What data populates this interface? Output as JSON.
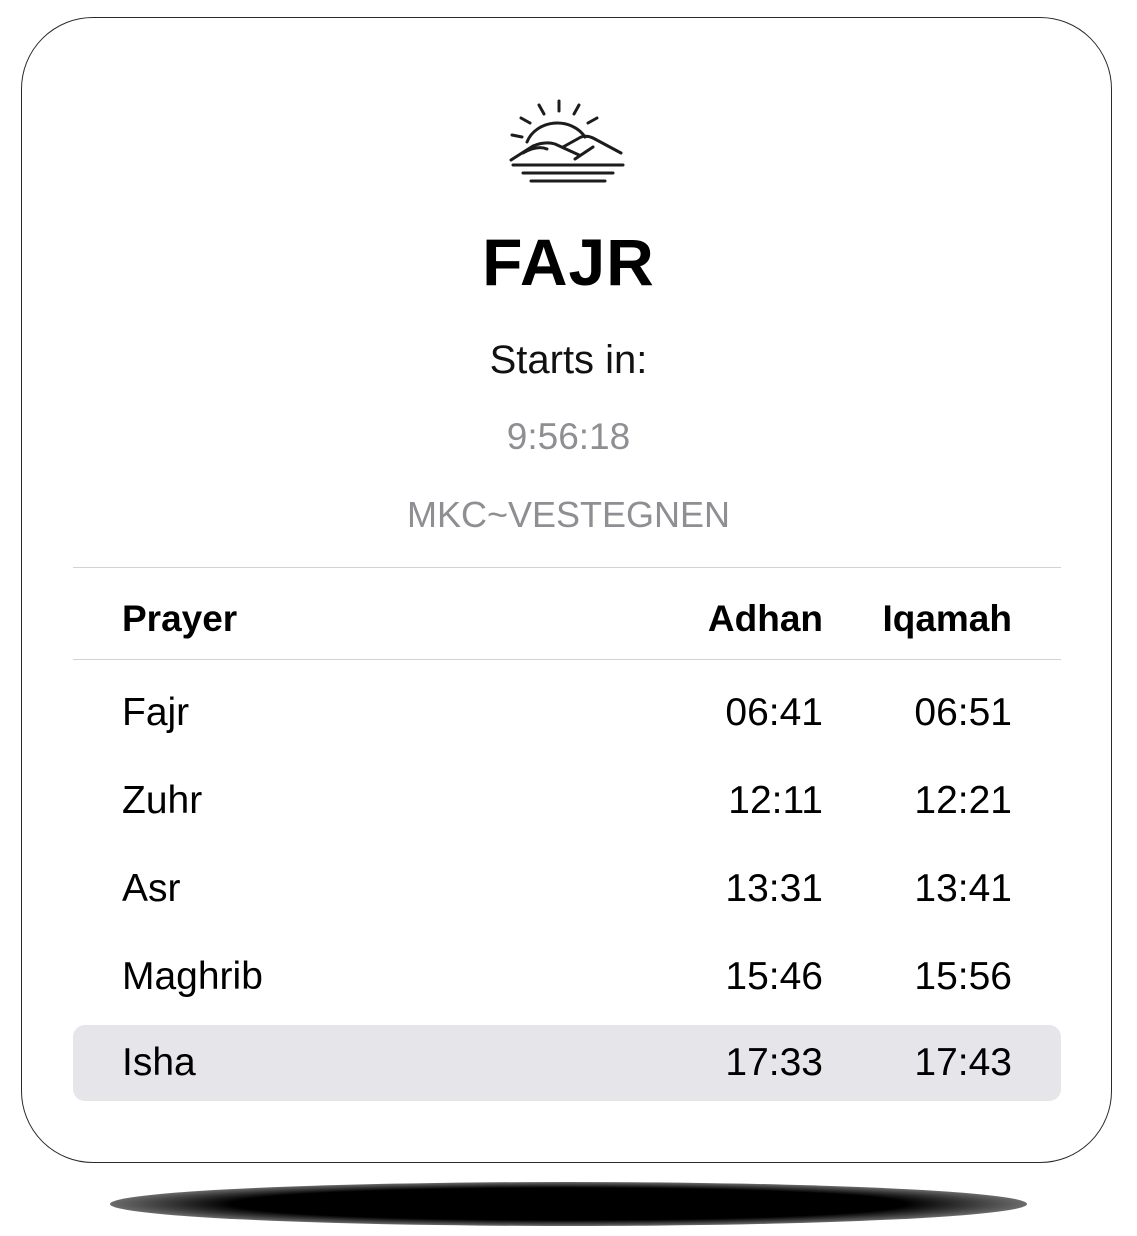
{
  "widget": {
    "icon": "sunrise-icon",
    "next_prayer": "FAJR",
    "starts_label": "Starts in:",
    "countdown": "9:56:18",
    "location": "MKC~VESTEGNEN"
  },
  "table": {
    "headers": {
      "prayer": "Prayer",
      "adhan": "Adhan",
      "iqamah": "Iqamah"
    },
    "rows": [
      {
        "prayer": "Fajr",
        "adhan": "06:41",
        "iqamah": "06:51"
      },
      {
        "prayer": "Zuhr",
        "adhan": "12:11",
        "iqamah": "12:21"
      },
      {
        "prayer": "Asr",
        "adhan": "13:31",
        "iqamah": "13:41"
      },
      {
        "prayer": "Maghrib",
        "adhan": "15:46",
        "iqamah": "15:56"
      },
      {
        "prayer": "Isha",
        "adhan": "17:33",
        "iqamah": "17:43"
      }
    ]
  },
  "colors": {
    "text_primary": "#000000",
    "text_secondary": "#8e8e93",
    "highlight_row": "#e5e5ea",
    "divider": "#d1d1d6"
  }
}
